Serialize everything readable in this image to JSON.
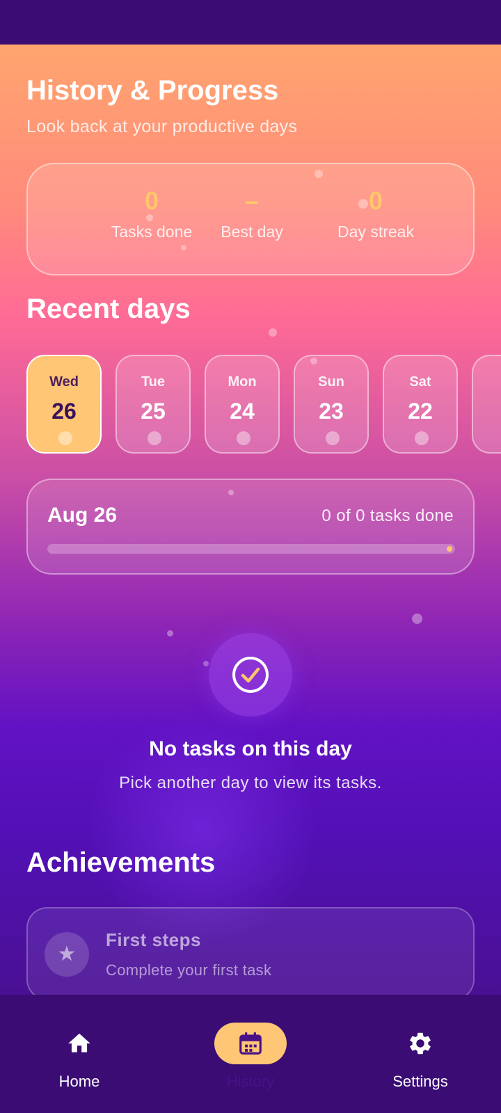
{
  "header": {
    "title": "History & Progress",
    "subtitle": "Look back at your productive days"
  },
  "stats": [
    {
      "value": "0",
      "label": "Tasks done"
    },
    {
      "value": "–",
      "label": "Best day"
    },
    {
      "value": "0",
      "label": "Day streak"
    }
  ],
  "recent": {
    "title": "Recent days",
    "days": [
      {
        "name": "Wed",
        "num": "26",
        "selected": true
      },
      {
        "name": "Tue",
        "num": "25",
        "selected": false
      },
      {
        "name": "Mon",
        "num": "24",
        "selected": false
      },
      {
        "name": "Sun",
        "num": "23",
        "selected": false
      },
      {
        "name": "Sat",
        "num": "22",
        "selected": false
      }
    ]
  },
  "day_summary": {
    "date": "Aug 26",
    "count": "0 of 0 tasks done",
    "progress": 0
  },
  "empty_state": {
    "title": "No tasks on this day",
    "subtitle": "Pick another day to view its tasks.",
    "icon": "check-circle-icon"
  },
  "achievements": {
    "title": "Achievements",
    "items": [
      {
        "title": "First steps",
        "description": "Complete your first task",
        "icon": "star-icon",
        "unlocked": false
      }
    ]
  },
  "nav": {
    "items": [
      {
        "label": "Home",
        "icon": "home-icon",
        "active": false
      },
      {
        "label": "History",
        "icon": "calendar-icon",
        "active": true
      },
      {
        "label": "Settings",
        "icon": "gear-icon",
        "active": false
      }
    ]
  },
  "colors": {
    "accent": "#ffc675",
    "nav_bg": "#3a0c74"
  }
}
